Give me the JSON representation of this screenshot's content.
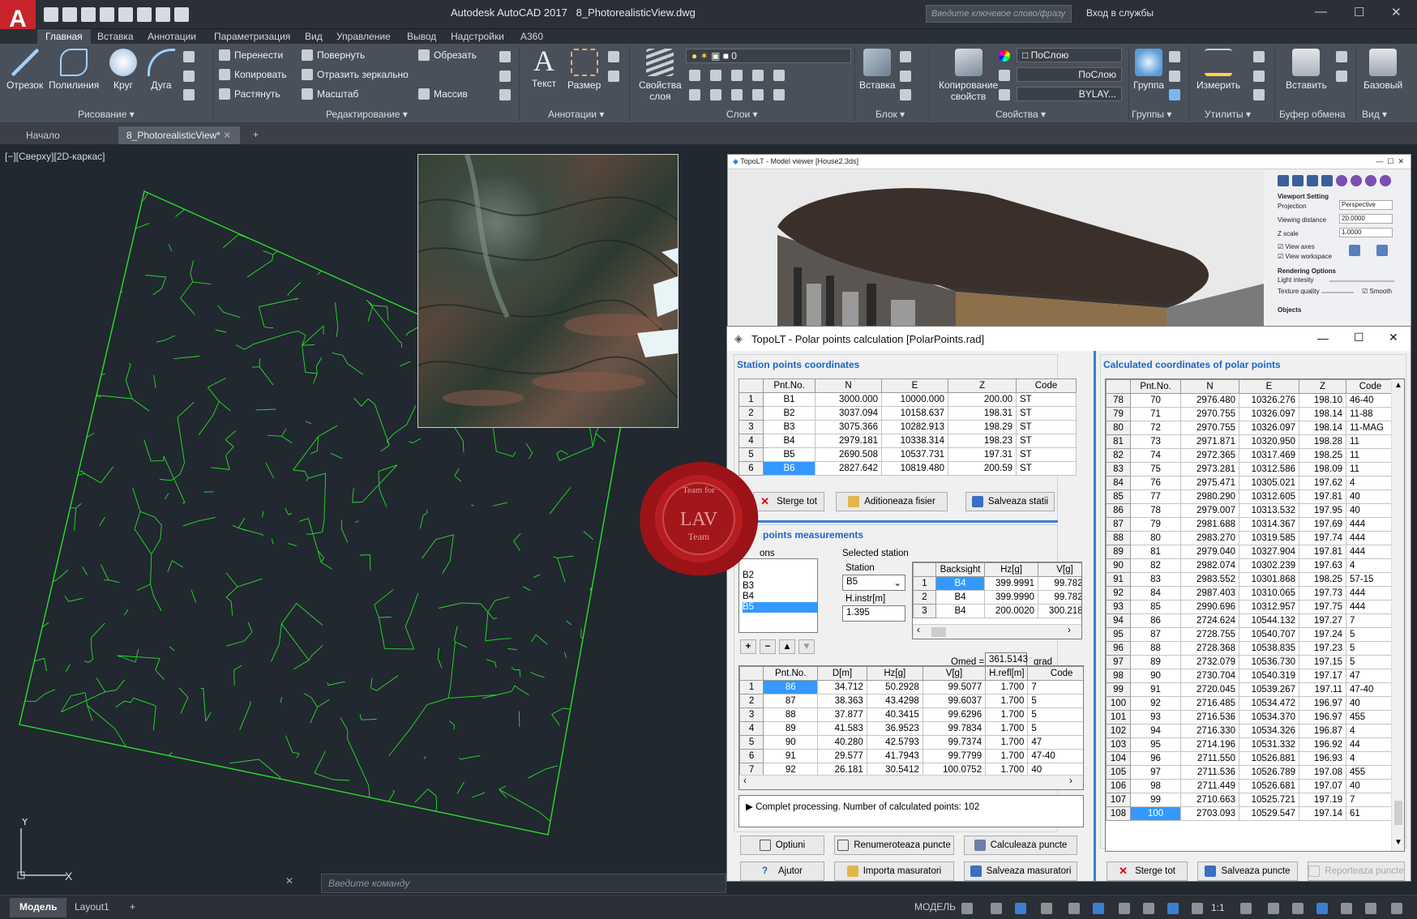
{
  "app": {
    "title": "Autodesk AutoCAD 2017",
    "doc_title": "8_PhotorealisticView.dwg",
    "logo": "A",
    "search_placeholder": "Введите ключевое слово/фразу",
    "signin": "Вход в службы"
  },
  "ribbon_tabs": [
    "Главная",
    "Вставка",
    "Аннотации",
    "Параметризация",
    "Вид",
    "Управление",
    "Вывод",
    "Надстройки",
    "A360"
  ],
  "ribbon": {
    "draw": {
      "tools": [
        "Отрезок",
        "Полилиния",
        "Круг",
        "Дуга"
      ],
      "panel": "Рисование ▾"
    },
    "modify": {
      "items": [
        "Перенести",
        "Повернуть",
        "Обрезать",
        "Копировать",
        "Отразить зеркально",
        "Растянуть",
        "Масштаб",
        "Массив"
      ],
      "panel": "Редактирование ▾"
    },
    "annot": {
      "tools": [
        "Текст",
        "Размер"
      ],
      "panel": "Аннотации ▾"
    },
    "layers": {
      "tool_l1": "Свойства",
      "tool_l2": "слоя",
      "layer_value": "0",
      "panel": "Слои ▾"
    },
    "block": {
      "tool": "Вставка",
      "panel": "Блок ▾"
    },
    "props": {
      "tool_l1": "Копирование",
      "tool_l2": "свойств",
      "color": "ПоСлою",
      "linetype": "ПоСлою",
      "lineweight": "BYLAY...",
      "panel": "Свойства ▾"
    },
    "groups": {
      "tool": "Группа",
      "panel": "Группы ▾"
    },
    "utils": {
      "tool": "Измерить",
      "panel": "Утилиты ▾"
    },
    "clip": {
      "tool": "Вставить",
      "panel": "Буфер обмена"
    },
    "view": {
      "tool": "Базовый",
      "panel": "Вид ▾"
    }
  },
  "doc_tabs": {
    "start": "Начало",
    "file": "8_PhotorealisticView*",
    "add": "+"
  },
  "viewport_label": "[−][Сверху][2D-каркас]",
  "viewer": {
    "title": "TopoLT - Model viewer [House2.3ds]",
    "vs_heading": "Viewport Setting",
    "projection_label": "Projection",
    "projection": "Perspective",
    "dist_label": "Viewing distance",
    "dist": "20.0000",
    "z_label": "Z scale",
    "z": "1.0000",
    "axes": "View axes",
    "workspace": "View workspace",
    "render_heading": "Rendering Options",
    "light": "Light intesity",
    "texture": "Texture quality",
    "smooth": "Smooth",
    "objects": "Objects"
  },
  "dialog": {
    "title": "TopoLT - Polar points calculation [PolarPoints.rad]",
    "station_title": "Station points coordinates",
    "station_headers": [
      "Pnt.No.",
      "N",
      "E",
      "Z",
      "Code"
    ],
    "stations": [
      [
        "1",
        "B1",
        "3000.000",
        "10000.000",
        "200.00",
        "ST"
      ],
      [
        "2",
        "B2",
        "3037.094",
        "10158.637",
        "198.31",
        "ST"
      ],
      [
        "3",
        "B3",
        "3075.366",
        "10282.913",
        "198.29",
        "ST"
      ],
      [
        "4",
        "B4",
        "2979.181",
        "10338.314",
        "198.23",
        "ST"
      ],
      [
        "5",
        "B5",
        "2690.508",
        "10537.731",
        "197.31",
        "ST"
      ],
      [
        "6",
        "B6",
        "2827.642",
        "10819.480",
        "200.59",
        "ST"
      ]
    ],
    "btn_clear": "Sterge tot",
    "btn_add_file": "Aditioneaza fisier",
    "btn_save_st": "Salveaza statii",
    "meas_title": "points measurements",
    "stations_label": "ons",
    "station_list": [
      "B2",
      "B3",
      "B4",
      "B5"
    ],
    "selected_station": "Selected station",
    "station_lbl": "Station",
    "station_val": "B5",
    "hinstr_lbl": "H.instr[m]",
    "hinstr_val": "1.395",
    "back_headers": [
      "Backsight",
      "Hz[g]",
      "V[g]"
    ],
    "backs": [
      [
        "1",
        "B4",
        "399.9991",
        "99.7822"
      ],
      [
        "2",
        "B4",
        "399.9990",
        "99.7821"
      ],
      [
        "3",
        "B4",
        "200.0020",
        "300.2187"
      ]
    ],
    "omed_lbl": "Omed =",
    "omed_val": "361.5143",
    "omed_unit": "grad",
    "list_btns": [
      "+",
      "−",
      "▲",
      "▼"
    ],
    "meas_headers": [
      "Pnt.No.",
      "D[m]",
      "Hz[g]",
      "V[g]",
      "H.refl[m]",
      "Code"
    ],
    "meas": [
      [
        "1",
        "86",
        "34.712",
        "50.2928",
        "99.5077",
        "1.700",
        "7"
      ],
      [
        "2",
        "87",
        "38.363",
        "43.4298",
        "99.6037",
        "1.700",
        "5"
      ],
      [
        "3",
        "88",
        "37.877",
        "40.3415",
        "99.6296",
        "1.700",
        "5"
      ],
      [
        "4",
        "89",
        "41.583",
        "36.9523",
        "99.7834",
        "1.700",
        "5"
      ],
      [
        "5",
        "90",
        "40.280",
        "42.5793",
        "99.7374",
        "1.700",
        "47"
      ],
      [
        "6",
        "91",
        "29.577",
        "41.7943",
        "99.7799",
        "1.700",
        "47-40"
      ],
      [
        "7",
        "92",
        "26.181",
        "30.5412",
        "100.0752",
        "1.700",
        "40"
      ]
    ],
    "log": "Complet processing. Number of calculated points: 102",
    "btns_bottom": [
      "Optiuni",
      "Renumeroteaza puncte",
      "Calculeaza puncte",
      "Ajutor",
      "Importa masuratori",
      "Salveaza masuratori"
    ],
    "calc_title": "Calculated coordinates of polar points",
    "calc_headers": [
      "Pnt.No.",
      "N",
      "E",
      "Z",
      "Code"
    ],
    "calc": [
      [
        "78",
        "70",
        "2976.480",
        "10326.276",
        "198.10",
        "46-40"
      ],
      [
        "79",
        "71",
        "2970.755",
        "10326.097",
        "198.14",
        "11-88"
      ],
      [
        "80",
        "72",
        "2970.755",
        "10326.097",
        "198.14",
        "11-MAG"
      ],
      [
        "81",
        "73",
        "2971.871",
        "10320.950",
        "198.28",
        "11"
      ],
      [
        "82",
        "74",
        "2972.365",
        "10317.469",
        "198.25",
        "11"
      ],
      [
        "83",
        "75",
        "2973.281",
        "10312.586",
        "198.09",
        "11"
      ],
      [
        "84",
        "76",
        "2975.471",
        "10305.021",
        "197.62",
        "4"
      ],
      [
        "85",
        "77",
        "2980.290",
        "10312.605",
        "197.81",
        "40"
      ],
      [
        "86",
        "78",
        "2979.007",
        "10313.532",
        "197.95",
        "40"
      ],
      [
        "87",
        "79",
        "2981.688",
        "10314.367",
        "197.69",
        "444"
      ],
      [
        "88",
        "80",
        "2983.270",
        "10319.585",
        "197.74",
        "444"
      ],
      [
        "89",
        "81",
        "2979.040",
        "10327.904",
        "197.81",
        "444"
      ],
      [
        "90",
        "82",
        "2982.074",
        "10302.239",
        "197.63",
        "4"
      ],
      [
        "91",
        "83",
        "2983.552",
        "10301.868",
        "198.25",
        "57-15"
      ],
      [
        "92",
        "84",
        "2987.403",
        "10310.065",
        "197.73",
        "444"
      ],
      [
        "93",
        "85",
        "2990.696",
        "10312.957",
        "197.75",
        "444"
      ],
      [
        "94",
        "86",
        "2724.624",
        "10544.132",
        "197.27",
        "7"
      ],
      [
        "95",
        "87",
        "2728.755",
        "10540.707",
        "197.24",
        "5"
      ],
      [
        "96",
        "88",
        "2728.368",
        "10538.835",
        "197.23",
        "5"
      ],
      [
        "97",
        "89",
        "2732.079",
        "10536.730",
        "197.15",
        "5"
      ],
      [
        "98",
        "90",
        "2730.704",
        "10540.319",
        "197.17",
        "47"
      ],
      [
        "99",
        "91",
        "2720.045",
        "10539.267",
        "197.11",
        "47-40"
      ],
      [
        "100",
        "92",
        "2716.485",
        "10534.472",
        "196.97",
        "40"
      ],
      [
        "101",
        "93",
        "2716.536",
        "10534.370",
        "196.97",
        "455"
      ],
      [
        "102",
        "94",
        "2716.330",
        "10534.326",
        "196.87",
        "4"
      ],
      [
        "103",
        "95",
        "2714.196",
        "10531.332",
        "196.92",
        "44"
      ],
      [
        "104",
        "96",
        "2711.550",
        "10526.881",
        "196.93",
        "4"
      ],
      [
        "105",
        "97",
        "2711.536",
        "10526.789",
        "197.08",
        "455"
      ],
      [
        "106",
        "98",
        "2711.449",
        "10526.681",
        "197.07",
        "40"
      ],
      [
        "107",
        "99",
        "2710.663",
        "10525.721",
        "197.19",
        "7"
      ],
      [
        "108",
        "100",
        "2703.093",
        "10529.547",
        "197.14",
        "61"
      ]
    ],
    "calc_btns": [
      "Sterge tot",
      "Salveaza puncte",
      "Reporteaza puncte"
    ]
  },
  "seal": {
    "top": "Team for",
    "main": "LAV",
    "sub": "Team"
  },
  "command_placeholder": "Введите команду",
  "status": {
    "model_tab": "Модель",
    "layout_tab": "Layout1",
    "add": "+",
    "mode": "МОДЕЛЬ",
    "scale": "1:1"
  },
  "ucs": {
    "x": "X",
    "y": "Y"
  }
}
